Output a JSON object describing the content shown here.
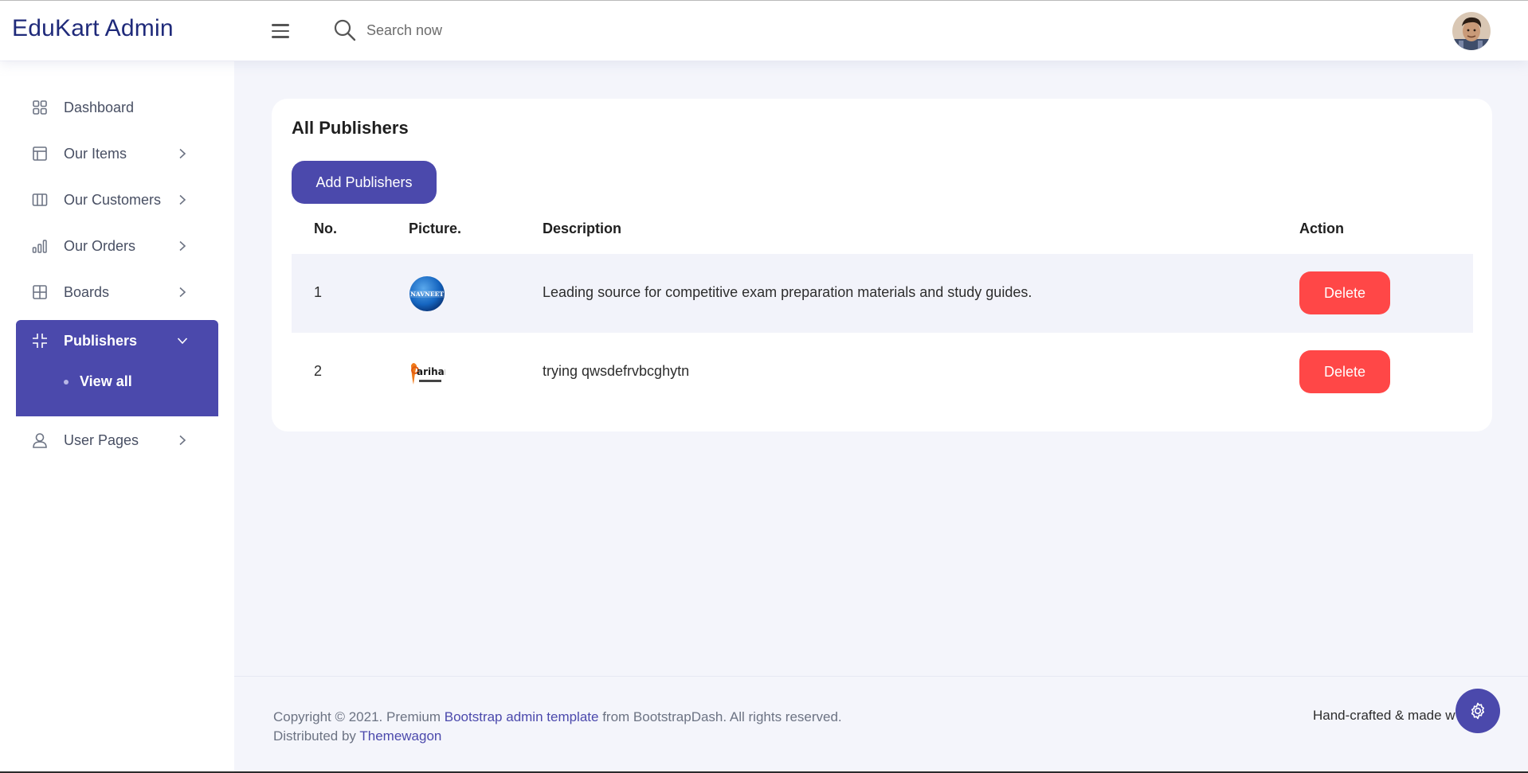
{
  "header": {
    "brand": "EduKart Admin",
    "search_placeholder": "Search now"
  },
  "sidebar": {
    "items": [
      {
        "label": "Dashboard",
        "icon": "grid-icon"
      },
      {
        "label": "Our Items",
        "icon": "layout-icon"
      },
      {
        "label": "Our Customers",
        "icon": "columns-icon"
      },
      {
        "label": "Our Orders",
        "icon": "bar-chart-icon"
      },
      {
        "label": "Boards",
        "icon": "table-grid-icon"
      },
      {
        "label": "Publishers",
        "icon": "compress-icon"
      },
      {
        "label": "User Pages",
        "icon": "user-icon"
      }
    ],
    "active_sub": "View all"
  },
  "main": {
    "title": "All Publishers",
    "add_button": "Add Publishers",
    "columns": [
      "No.",
      "Picture.",
      "Description",
      "Action"
    ],
    "rows": [
      {
        "no": "1",
        "logo": "NAVNEET",
        "description": "Leading source for competitive exam preparation materials and study guides.",
        "action": "Delete"
      },
      {
        "no": "2",
        "logo": "arihant",
        "description": "trying qwsdefrvbcghytn",
        "action": "Delete"
      }
    ]
  },
  "footer": {
    "copyright_prefix": "Copyright © 2021. Premium",
    "template_link": "Bootstrap admin template",
    "copyright_suffix": "from BootstrapDash. All rights reserved.",
    "distributed_prefix": "Distributed by",
    "distributed_link": "Themewagon",
    "handmade": "Hand-crafted & made w"
  },
  "colors": {
    "accent": "#4b49ac",
    "danger": "#ff4747",
    "background": "#f4f5fb"
  }
}
